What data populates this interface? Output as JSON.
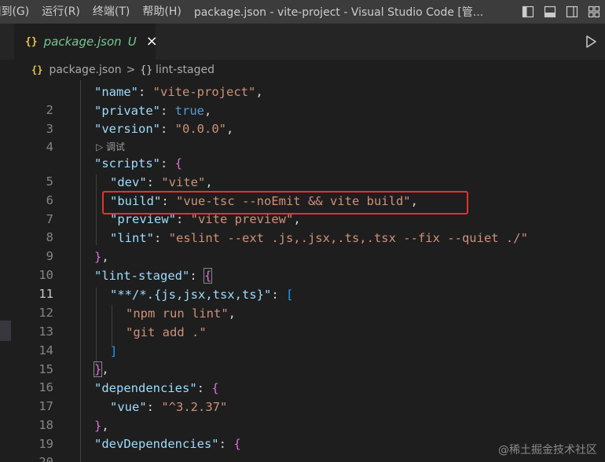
{
  "menu": {
    "items": [
      "]到(G)",
      "运行(R)",
      "终端(T)",
      "帮助(H)"
    ]
  },
  "window_title": "package.json - vite-project - Visual Studio Code [管...",
  "tab": {
    "icon": "{}",
    "name": "package.json",
    "status": "U",
    "close": "×"
  },
  "breadcrumb": {
    "icon": "{}",
    "file": "package.json",
    "separator": ">",
    "section_icon": "{}",
    "section": "lint-staged"
  },
  "codelens": "▷ 调试",
  "lines": [
    {
      "n": "2",
      "text": "\"name\": \"vite-project\","
    },
    {
      "n": "3",
      "text": "\"private\": true,"
    },
    {
      "n": "4",
      "text": "\"version\": \"0.0.0\","
    },
    {
      "n": "5",
      "text": "\"scripts\": {"
    },
    {
      "n": "6",
      "text": "\"dev\": \"vite\","
    },
    {
      "n": "7",
      "text": "\"build\": \"vue-tsc --noEmit && vite build\","
    },
    {
      "n": "8",
      "text": "\"preview\": \"vite preview\","
    },
    {
      "n": "9",
      "text": "\"lint\": \"eslint --ext .js,.jsx,.ts,.tsx --fix --quiet ./\""
    },
    {
      "n": "10",
      "text": "},"
    },
    {
      "n": "11",
      "text": "\"lint-staged\": {"
    },
    {
      "n": "12",
      "text": "\"**/*.{js,jsx,tsx,ts}\": ["
    },
    {
      "n": "13",
      "text": "\"npm run lint\","
    },
    {
      "n": "14",
      "text": "\"git add .\""
    },
    {
      "n": "15",
      "text": "]"
    },
    {
      "n": "16",
      "text": "},"
    },
    {
      "n": "17",
      "text": "\"dependencies\": {"
    },
    {
      "n": "18",
      "text": "\"vue\": \"^3.2.37\""
    },
    {
      "n": "19",
      "text": "},"
    },
    {
      "n": "20",
      "text": "\"devDependencies\": {"
    }
  ],
  "active_line": "11",
  "watermark": "@稀土掘金技术社区",
  "colors": {
    "key": "#9cdcfe",
    "string": "#ce9178",
    "boolean": "#569cd6",
    "highlight_box": "#e5312f",
    "untracked": "#73c991"
  }
}
